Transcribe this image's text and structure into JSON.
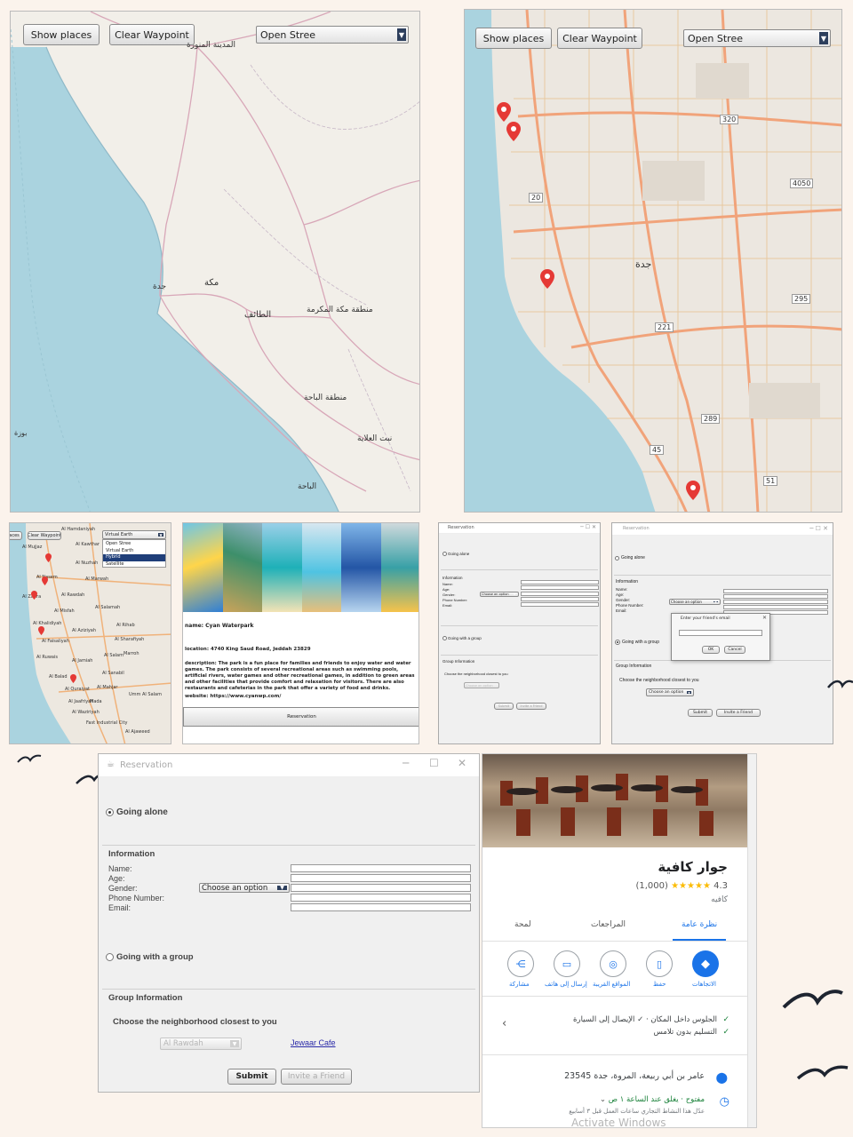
{
  "map_toolbar": {
    "show_places": "Show places",
    "clear_waypoint": "Clear Waypoint",
    "tile_selected": "Open Stree"
  },
  "map_large_left": {
    "labels": [
      "المدينة المنورة",
      "جدة",
      "مكة",
      "الطائف",
      "منطقة مكة المكرمة",
      "منطقة الباحة",
      "الباحة",
      "نبت العلاية",
      "بوزة"
    ]
  },
  "map_large_right": {
    "labels": [
      "جدة"
    ],
    "route_shields": [
      "320",
      "4050",
      "20",
      "295",
      "221",
      "289",
      "45",
      "51"
    ],
    "pin_color": "#e53935"
  },
  "map_small": {
    "clear_waypoint": "Clear Waypoint",
    "show_places_partial": "aces",
    "dropdown_selected": "Virtual Earth",
    "dropdown_options": [
      "Open Stree",
      "Virtual Earth",
      "Hybrid",
      "Satellite"
    ],
    "highlighted_option": "Hybrid",
    "labels": [
      "Al Hamdaniyah",
      "Al Kawthar",
      "Al Mujjaz",
      "Al Nuzhah",
      "Al Nasem",
      "Al Marwah",
      "Al Zahra",
      "Al Rawdah",
      "Al Salamah",
      "Al Khalidiyah",
      "Al Aziziyah",
      "Al Rihab",
      "Al Faisaliyah",
      "Al Sharafiyah",
      "Al Ruwais",
      "Al Jamiah",
      "Al Balad",
      "Al Sanabil",
      "Al Quraiyat",
      "Al Mahjar",
      "Al Jaafriyah",
      "Al Waziriyah",
      "Fast Industrial City",
      "Umm Al Salam",
      "Al Ajaweed",
      "Marroh",
      "Al Misfah",
      "Al Salam",
      "Mada"
    ]
  },
  "place_detail": {
    "name": "name: Cyan Waterpark",
    "location": "location: 4740 King Saud Road, Jeddah 23829",
    "description": "description: The park is a fun place for families and friends to enjoy water and water games. The park consists of several recreational areas such as swimming pools, artificial rivers, water games and other recreational games, in addition to green areas and other facilities that provide comfort and relaxation for visitors. There are also restaurants and cafeterias in the park that offer a variety of food and drinks.",
    "website": "website: https://www.cyanwp.com/",
    "reservation_button": "Reservation"
  },
  "reservation_form": {
    "window_title": "Reservation",
    "going_alone": "Going alone",
    "information_heading": "Information",
    "name_label": "Name:",
    "age_label": "Age:",
    "gender_label": "Gender:",
    "phone_label": "Phone Number:",
    "email_label": "Email:",
    "gender_placeholder": "Choose an option",
    "going_group": "Going with a group",
    "group_heading": "Group Information",
    "neighborhood_prompt": "Choose the neighborhood closest to you",
    "neighborhood_placeholder": "Choose an option",
    "neighborhood_selected": "Al Rawdah",
    "cafe_link": "Jewaar Cafe",
    "submit": "Submit",
    "invite": "Invite a Friend"
  },
  "invite_dialog": {
    "title": "Enter your friend's email",
    "ok": "OK",
    "cancel": "Cancel"
  },
  "cafe_card": {
    "title": "جوار كافية",
    "rating": "4.3",
    "stars": "★★★★★",
    "reviews": "(1,000)",
    "category": "كافيه",
    "tabs": [
      "نظرة عامة",
      "المراجعات",
      "لمحة"
    ],
    "actions": [
      "الاتجاهات",
      "حفظ",
      "المواقع القريبة",
      "إرسال إلى هاتف",
      "مشاركة"
    ],
    "feature_1": "الجلوس داخل المكان · ✓ الإيصال إلى السيارة",
    "feature_2": "التسليم بدون تلامس",
    "address": "عامر بن أبي ربيعة، المروة، جدة 23545",
    "hours": "مفتوح · يغلق عند الساعة ١ ص",
    "hours_note": "عدّل هذا النشاط التجاري ساعات العمل قبل ٣ أسابيع",
    "watermark": "Activate Windows",
    "accent": "#1a73e8",
    "star_color": "#fbbc04"
  }
}
